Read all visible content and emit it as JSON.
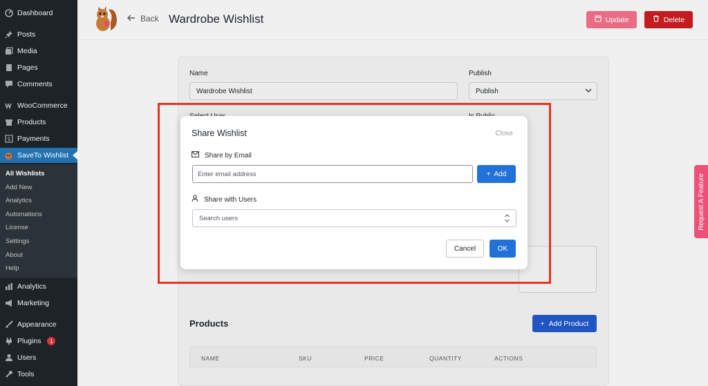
{
  "sidebar": {
    "items": [
      {
        "label": "Dashboard",
        "icon": "dashboard-icon"
      },
      {
        "label": "Posts",
        "icon": "pin-icon"
      },
      {
        "label": "Media",
        "icon": "media-icon"
      },
      {
        "label": "Pages",
        "icon": "pages-icon"
      },
      {
        "label": "Comments",
        "icon": "comments-icon"
      },
      {
        "label": "WooCommerce",
        "icon": "woocommerce-icon"
      },
      {
        "label": "Products",
        "icon": "archive-icon"
      },
      {
        "label": "Payments",
        "icon": "dollar-icon"
      },
      {
        "label": "SaveTo Wishlist",
        "icon": "squirrel-icon"
      },
      {
        "label": "Analytics",
        "icon": "bar-chart-icon"
      },
      {
        "label": "Marketing",
        "icon": "megaphone-icon"
      },
      {
        "label": "Appearance",
        "icon": "brush-icon"
      },
      {
        "label": "Plugins",
        "icon": "plugin-icon",
        "badge": "1"
      },
      {
        "label": "Users",
        "icon": "user-icon"
      },
      {
        "label": "Tools",
        "icon": "wrench-icon"
      }
    ],
    "submenu": [
      "All Wishlists",
      "Add New",
      "Analytics",
      "Automations",
      "License",
      "Settings",
      "About",
      "Help"
    ]
  },
  "header": {
    "back_label": "Back",
    "title": "Wardrobe Wishlist",
    "update_label": "Update",
    "delete_label": "Delete"
  },
  "form": {
    "name_label": "Name",
    "name_value": "Wardrobe Wishlist",
    "publish_label": "Publish",
    "publish_value": "Publish",
    "select_user_label": "Select User",
    "is_public_label": "Is Public"
  },
  "products": {
    "title": "Products",
    "add_label": "Add Product",
    "columns": [
      "NAME",
      "SKU",
      "PRICE",
      "QUANTITY",
      "ACTIONS"
    ]
  },
  "modal": {
    "title": "Share Wishlist",
    "close_label": "Close",
    "email_section_label": "Share by Email",
    "email_placeholder": "Enter email address",
    "add_label": "Add",
    "users_section_label": "Share with Users",
    "users_placeholder": "Search users",
    "cancel_label": "Cancel",
    "ok_label": "OK"
  },
  "feature_tab": "Request A Feature",
  "colors": {
    "sidebar_bg": "#1d2327",
    "wp_blue": "#2271b1",
    "primary": "#2271d9",
    "delete": "#c21c21",
    "update": "#e96b84",
    "highlight": "#e8321c",
    "feature_tab": "#ee5078"
  }
}
